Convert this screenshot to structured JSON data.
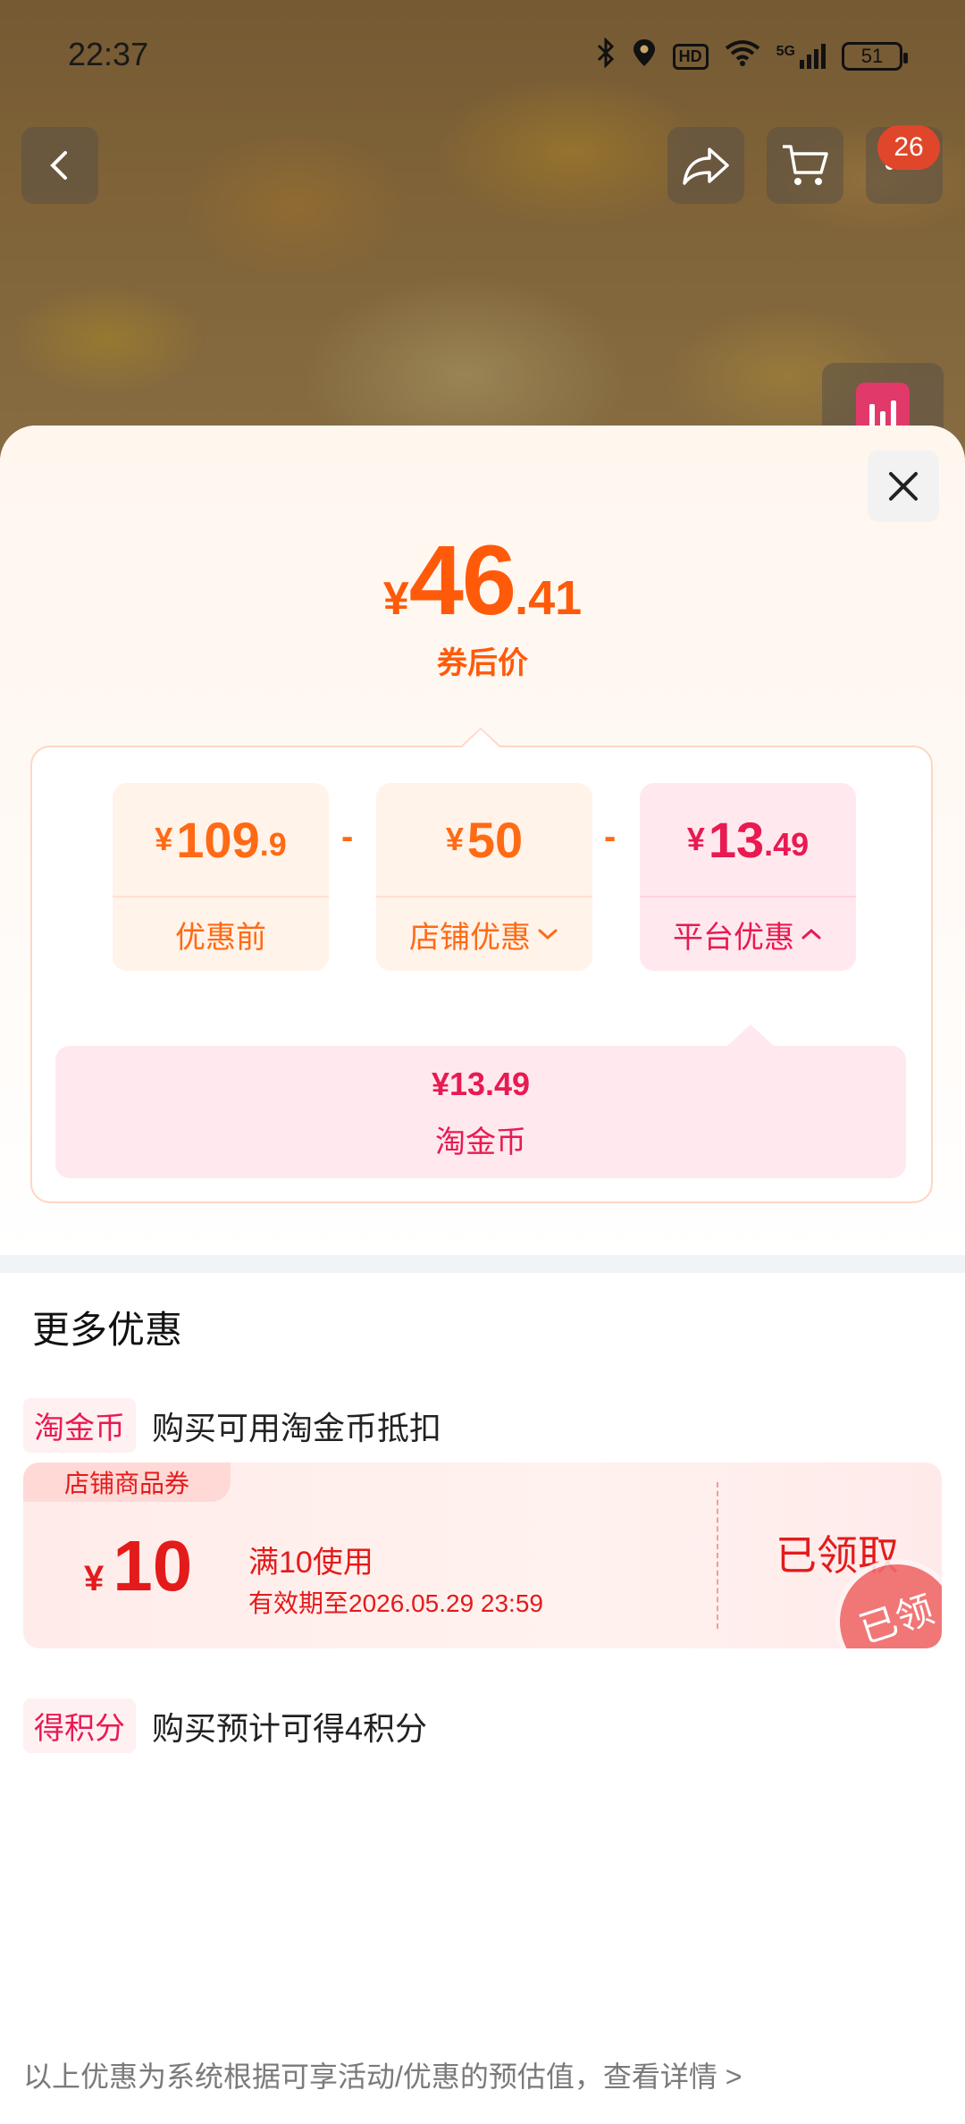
{
  "status_bar": {
    "time": "22:37",
    "icons": [
      "bluetooth-icon",
      "location-icon",
      "hd-icon",
      "wifi-icon",
      "signal-5g-icon"
    ],
    "hd_label": "HD",
    "signal_label": "5G",
    "battery": "51"
  },
  "top_bar": {
    "cart_badge": "26"
  },
  "sheet": {
    "price": {
      "symbol": "¥",
      "integer": "46",
      "decimal": ".41",
      "label": "券后价"
    },
    "breakdown": {
      "before": {
        "symbol": "¥",
        "integer": "109",
        "decimal": ".9",
        "label": "优惠前"
      },
      "store": {
        "symbol": "¥",
        "integer": "50",
        "decimal": "",
        "label": "店铺优惠"
      },
      "platform": {
        "symbol": "¥",
        "integer": "13",
        "decimal": ".49",
        "label": "平台优惠"
      },
      "minus": "-",
      "coin_value": "¥13.49",
      "coin_label": "淘金币"
    },
    "more": {
      "title": "更多优惠",
      "coin_row": {
        "tag": "淘金币",
        "text": "购买可用淘金币抵扣"
      },
      "coupon": {
        "tag": "店铺商品券",
        "symbol": "¥",
        "amount": "10",
        "condition": "满10使用",
        "expiry": "有效期至2026.05.29 23:59",
        "status": "已领取",
        "stamp": "已领"
      },
      "points_row": {
        "tag": "得积分",
        "text": "购买预计可得4积分"
      }
    },
    "footer": "以上优惠为系统根据可享活动/优惠的预估值，查看详情 >"
  },
  "colors": {
    "accent_orange": "#ff5a0a",
    "accent_pink": "#e81a52",
    "coupon_red": "#e31b1b"
  }
}
